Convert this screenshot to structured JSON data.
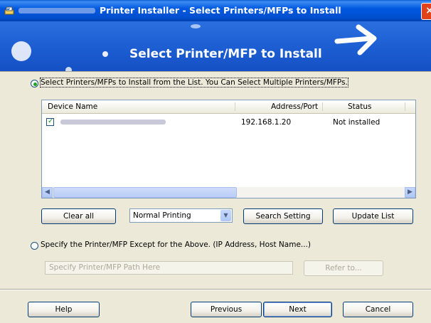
{
  "window": {
    "title": "Printer Installer - Select Printers/MFPs to Install",
    "title_prefix_redacted": true,
    "close_label": "×",
    "accent": "#0058e0",
    "close_color": "#e0431c"
  },
  "banner": {
    "heading": "Select Printer/MFP to Install"
  },
  "select_option": {
    "label": "Select Printers/MFPs to Install from the List. You Can Select Multiple Printers/MFPs.",
    "selected": true
  },
  "device_list": {
    "columns": [
      "Device Name",
      "Address/Port",
      "Status"
    ],
    "rows": [
      {
        "checked": true,
        "device_name_redacted": true,
        "address": "192.168.1.20",
        "status": "Not installed"
      }
    ]
  },
  "buttons": {
    "clear_all": "Clear all",
    "search_setting": "Search Setting",
    "update_list": "Update List",
    "refer_to": "Refer to...",
    "help": "Help",
    "previous": "Previous",
    "next": "Next",
    "cancel": "Cancel"
  },
  "print_mode": {
    "selected": "Normal Printing"
  },
  "specify_option": {
    "label": "Specify the Printer/MFP Except for the Above. (IP Address, Host Name...)",
    "selected": false
  },
  "path_field": {
    "placeholder": "Specify Printer/MFP Path Here"
  }
}
